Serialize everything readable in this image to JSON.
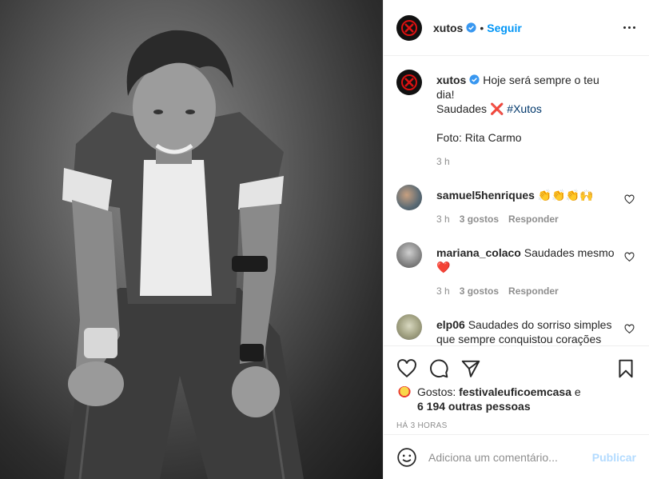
{
  "post": {
    "username": "xutos",
    "follow_label": "Seguir",
    "separator": "•"
  },
  "caption": {
    "username": "xutos",
    "line1": "Hoje será sempre o teu dia!",
    "line2_text": "Saudades",
    "line2_emoji": "❌",
    "hashtag": "#Xutos",
    "photo_credit": "Foto: Rita Carmo",
    "time": "3 h"
  },
  "comments": [
    {
      "username": "samuel5henriques",
      "text": "👏👏👏🙌",
      "time": "3 h",
      "likes": "3 gostos",
      "reply": "Responder",
      "avatar_color": "#7a8a96"
    },
    {
      "username": "mariana_colaco",
      "text": "Saudades mesmo ❤️",
      "time": "3 h",
      "likes": "3 gostos",
      "reply": "Responder",
      "avatar_color": "#9a9a9a"
    },
    {
      "username": "elp06",
      "text": "Saudades do sorriso simples que sempre conquistou corações 😢❤️",
      "time": "",
      "likes": "",
      "reply": "",
      "avatar_color": "#a8a890"
    }
  ],
  "likes": {
    "prefix": "Gostos:",
    "first_liker": "festivaleuficoemcasa",
    "joiner": "e",
    "others": "6 194 outras pessoas"
  },
  "posted_ago": "HÁ 3 HORAS",
  "add_comment": {
    "placeholder": "Adiciona um comentário...",
    "publish_label": "Publicar"
  },
  "colors": {
    "accent": "#0095f6",
    "publish_disabled": "#b3dbff",
    "muted": "#8e8e8e"
  },
  "icons": [
    "xutos-logo-icon",
    "verified-icon",
    "more-options-icon",
    "heart-icon",
    "comment-icon",
    "share-icon",
    "bookmark-icon",
    "emoji-icon"
  ]
}
